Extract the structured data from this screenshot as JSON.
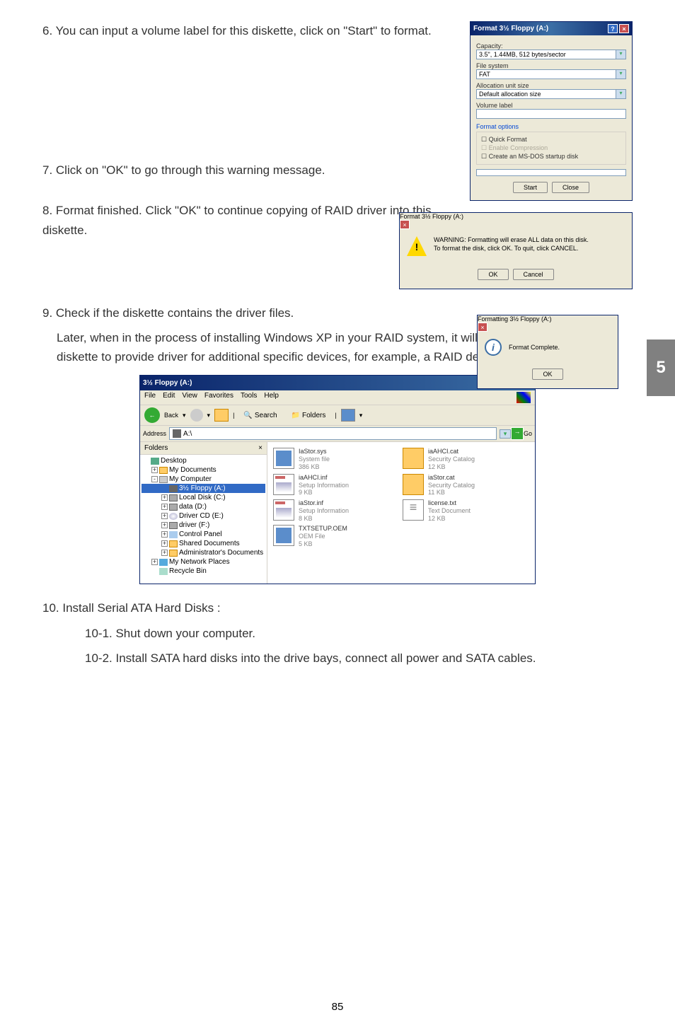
{
  "steps": {
    "s6": "6. You can input a volume label for this diskette, click on \"Start\" to format.",
    "s7": "7. Click on \"OK\" to go through this warning message.",
    "s8": "8. Format finished. Click \"OK\" to continue copying of RAID driver into this diskette.",
    "s9_line1": "9. Check if the diskette contains the driver files.",
    "s9_line2": "Later, when in the process of installing Windows XP in your RAID system, it will ask you to use this floppy diskette to provide driver for additional specific devices, for example, a RAID device.",
    "s10": "10. Install Serial ATA Hard Disks :",
    "s10_1": "10-1. Shut down your computer.",
    "s10_2": "10-2. Install SATA hard disks into the drive bays, connect all power and SATA cables."
  },
  "format_dialog": {
    "title": "Format 3½ Floppy (A:)",
    "labels": {
      "capacity": "Capacity:",
      "capacity_val": "3.5\", 1.44MB, 512 bytes/sector",
      "filesystem": "File system",
      "filesystem_val": "FAT",
      "alloc": "Allocation unit size",
      "alloc_val": "Default allocation size",
      "volume": "Volume label",
      "format_options": "Format options",
      "quick": "Quick Format",
      "compression": "Enable Compression",
      "msdos": "Create an MS-DOS startup disk"
    },
    "buttons": {
      "start": "Start",
      "close": "Close"
    }
  },
  "warning_dialog": {
    "title": "Format 3½ Floppy (A:)",
    "text": "WARNING: Formatting will erase ALL data on this disk.\nTo format the disk, click OK. To quit, click CANCEL.",
    "ok": "OK",
    "cancel": "Cancel"
  },
  "complete_dialog": {
    "title": "Formatting 3½ Floppy (A:)",
    "text": "Format Complete.",
    "ok": "OK"
  },
  "side_tab": "5",
  "explorer": {
    "title": "3½ Floppy (A:)",
    "menu": [
      "File",
      "Edit",
      "View",
      "Favorites",
      "Tools",
      "Help"
    ],
    "toolbar": {
      "back": "Back",
      "search": "Search",
      "folders": "Folders"
    },
    "address_label": "Address",
    "address": "A:\\",
    "go": "Go",
    "folders_header": "Folders",
    "tree": [
      {
        "level": 0,
        "icon": "ico-desktop",
        "label": "Desktop",
        "expand": ""
      },
      {
        "level": 1,
        "icon": "ico-folder",
        "label": "My Documents",
        "expand": "+"
      },
      {
        "level": 1,
        "icon": "ico-computer",
        "label": "My Computer",
        "expand": "-"
      },
      {
        "level": 2,
        "icon": "ico-floppy",
        "label": "3½ Floppy (A:)",
        "expand": "",
        "selected": true
      },
      {
        "level": 2,
        "icon": "ico-disk",
        "label": "Local Disk (C:)",
        "expand": "+"
      },
      {
        "level": 2,
        "icon": "ico-disk",
        "label": "data (D:)",
        "expand": "+"
      },
      {
        "level": 2,
        "icon": "ico-cd",
        "label": "Driver CD (E:)",
        "expand": "+"
      },
      {
        "level": 2,
        "icon": "ico-disk",
        "label": "driver (F:)",
        "expand": "+"
      },
      {
        "level": 2,
        "icon": "ico-panel",
        "label": "Control Panel",
        "expand": "+"
      },
      {
        "level": 2,
        "icon": "ico-folder",
        "label": "Shared Documents",
        "expand": "+"
      },
      {
        "level": 2,
        "icon": "ico-folder",
        "label": "Administrator's Documents",
        "expand": "+"
      },
      {
        "level": 1,
        "icon": "ico-network",
        "label": "My Network Places",
        "expand": "+"
      },
      {
        "level": 1,
        "icon": "ico-bin",
        "label": "Recycle Bin",
        "expand": ""
      }
    ],
    "files": [
      {
        "name": "IaStor.sys",
        "type": "System file",
        "size": "386 KB",
        "icon": "sys"
      },
      {
        "name": "iaAHCI.cat",
        "type": "Security Catalog",
        "size": "12 KB",
        "icon": "cat"
      },
      {
        "name": "iaAHCI.inf",
        "type": "Setup Information",
        "size": "9 KB",
        "icon": "inf"
      },
      {
        "name": "iaStor.cat",
        "type": "Security Catalog",
        "size": "11 KB",
        "icon": "cat"
      },
      {
        "name": "iaStor.inf",
        "type": "Setup Information",
        "size": "8 KB",
        "icon": "inf"
      },
      {
        "name": "license.txt",
        "type": "Text Document",
        "size": "12 KB",
        "icon": "txt"
      },
      {
        "name": "TXTSETUP.OEM",
        "type": "OEM File",
        "size": "5 KB",
        "icon": "oem"
      }
    ]
  },
  "page": "85"
}
